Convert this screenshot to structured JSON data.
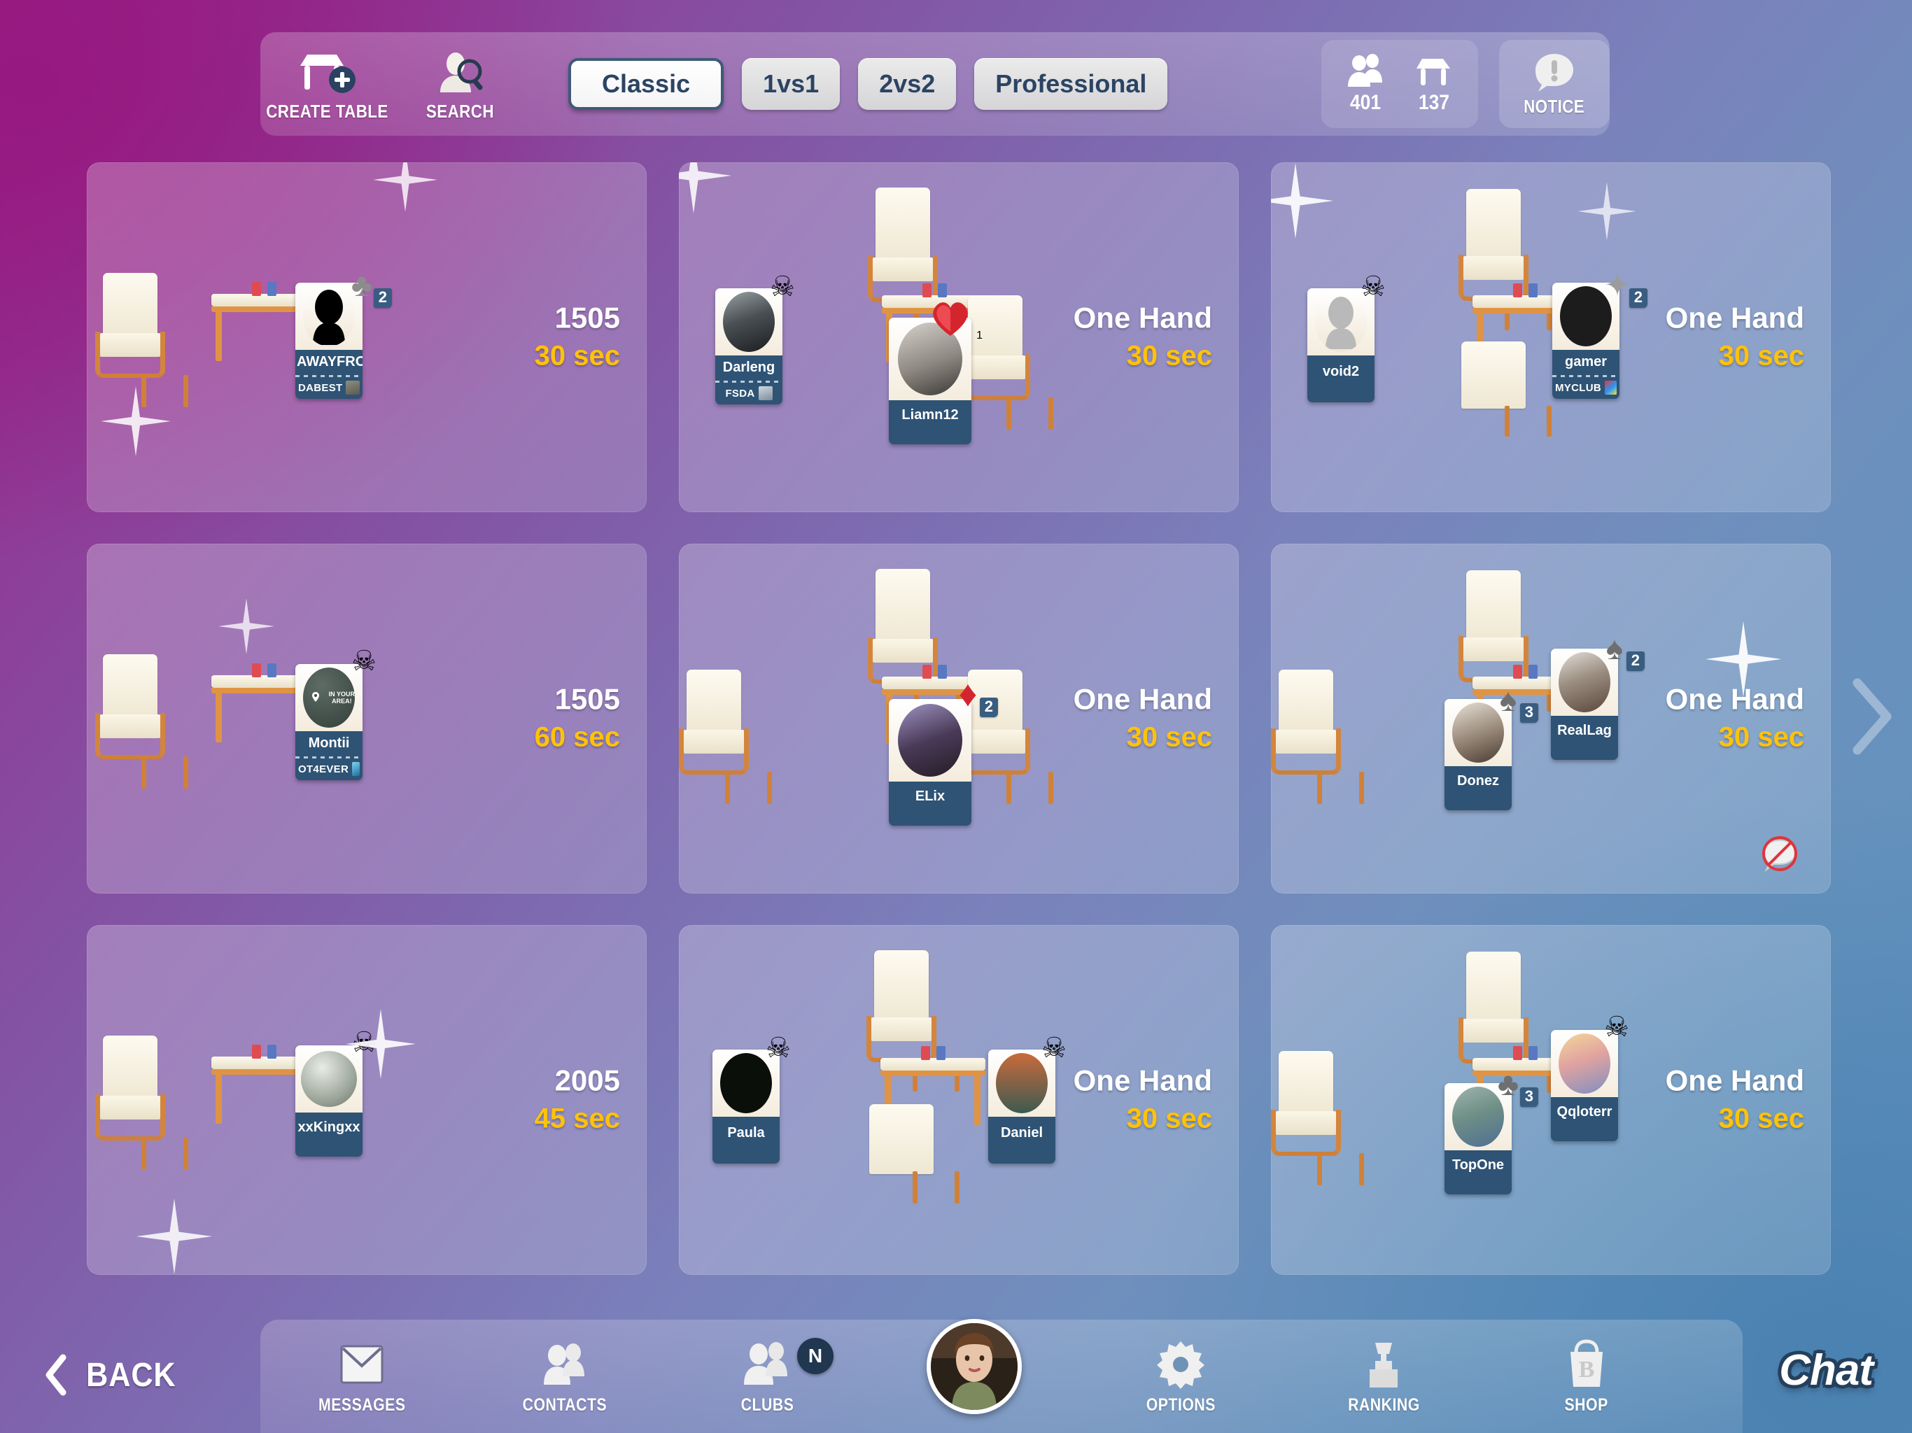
{
  "toolbar": {
    "create_table_label": "CREATE TABLE",
    "search_label": "SEARCH",
    "modes": [
      {
        "label": "Classic",
        "active": true
      },
      {
        "label": "1vs1",
        "active": false
      },
      {
        "label": "2vs2",
        "active": false
      },
      {
        "label": "Professional",
        "active": false
      }
    ],
    "players_online": "401",
    "tables_open": "137",
    "notice_label": "NOTICE"
  },
  "tables": [
    {
      "layout": "single-left",
      "meta_mode": "1505",
      "meta_time": "30 sec",
      "no_chat": false,
      "players": [
        {
          "name": "AWAYFRO",
          "club": "DABEST",
          "avatar_kind": "silhouette-dark",
          "suit": "club",
          "level": "2",
          "skull": false,
          "pos": "right"
        }
      ]
    },
    {
      "layout": "two-seat",
      "meta_mode": "One Hand",
      "meta_time": "30 sec",
      "no_chat": false,
      "players": [
        {
          "name": "Darleng",
          "club": "FSDA",
          "avatar_kind": "photo-goth",
          "suit": "",
          "level": "",
          "skull": true,
          "pos": "left"
        },
        {
          "name": "Liamn12",
          "club": "",
          "avatar_kind": "photo-man-glasses",
          "suit": "heart",
          "level": "1",
          "skull": false,
          "pos": "center"
        }
      ]
    },
    {
      "layout": "two-seat",
      "meta_mode": "One Hand",
      "meta_time": "30 sec",
      "no_chat": false,
      "players": [
        {
          "name": "void2",
          "club": "",
          "avatar_kind": "silhouette-grey",
          "suit": "",
          "level": "",
          "skull": true,
          "pos": "left"
        },
        {
          "name": "gamer",
          "club": "MYCLUB",
          "avatar_kind": "black-circle",
          "suit": "star",
          "level": "2",
          "skull": false,
          "pos": "right"
        }
      ]
    },
    {
      "layout": "single-left",
      "meta_mode": "1505",
      "meta_time": "60 sec",
      "no_chat": false,
      "players": [
        {
          "name": "Montii",
          "club": "OT4EVER",
          "avatar_kind": "in-your-area",
          "suit": "",
          "level": "",
          "skull": true,
          "pos": "right"
        }
      ]
    },
    {
      "layout": "two-seat",
      "meta_mode": "One Hand",
      "meta_time": "30 sec",
      "no_chat": false,
      "players": [
        {
          "name": "ELix",
          "club": "",
          "avatar_kind": "photo-cap-girl",
          "suit": "diamond",
          "level": "2",
          "skull": false,
          "pos": "center"
        }
      ]
    },
    {
      "layout": "two-seat",
      "meta_mode": "One Hand",
      "meta_time": "30 sec",
      "no_chat": true,
      "players": [
        {
          "name": "Donez",
          "club": "",
          "avatar_kind": "photo-girl-glasses",
          "suit": "spade",
          "level": "3",
          "skull": false,
          "pos": "centerleft"
        },
        {
          "name": "RealLag",
          "club": "",
          "avatar_kind": "photo-curly-man",
          "suit": "spade",
          "level": "2",
          "skull": false,
          "pos": "right"
        }
      ]
    },
    {
      "layout": "single-left",
      "meta_mode": "2005",
      "meta_time": "45 sec",
      "no_chat": false,
      "players": [
        {
          "name": "xxKingxx",
          "club": "",
          "avatar_kind": "grey-sphere",
          "suit": "",
          "level": "",
          "skull": true,
          "pos": "right"
        }
      ]
    },
    {
      "layout": "two-seat",
      "meta_mode": "One Hand",
      "meta_time": "30 sec",
      "no_chat": false,
      "players": [
        {
          "name": "Paula",
          "club": "",
          "avatar_kind": "black-oval",
          "suit": "",
          "level": "",
          "skull": true,
          "pos": "left"
        },
        {
          "name": "Daniel",
          "club": "",
          "avatar_kind": "photo-meme",
          "suit": "",
          "level": "",
          "skull": true,
          "pos": "right"
        }
      ]
    },
    {
      "layout": "two-seat",
      "meta_mode": "One Hand",
      "meta_time": "30 sec",
      "no_chat": false,
      "players": [
        {
          "name": "TopOne",
          "club": "",
          "avatar_kind": "photo-shoes",
          "suit": "club",
          "level": "3",
          "skull": false,
          "pos": "centerleft"
        },
        {
          "name": "Qqloterr",
          "club": "",
          "avatar_kind": "photo-blonde",
          "suit": "",
          "level": "",
          "skull": true,
          "pos": "right"
        }
      ]
    }
  ],
  "bottom_nav": {
    "back_label": "BACK",
    "items": [
      {
        "label": "MESSAGES",
        "icon": "envelope-icon",
        "badge": ""
      },
      {
        "label": "CONTACTS",
        "icon": "contacts-icon",
        "badge": ""
      },
      {
        "label": "CLUBS",
        "icon": "clubs-icon",
        "badge": "N"
      }
    ],
    "items_right": [
      {
        "label": "OPTIONS",
        "icon": "gear-icon",
        "badge": ""
      },
      {
        "label": "RANKING",
        "icon": "trophy-icon",
        "badge": ""
      },
      {
        "label": "SHOP",
        "icon": "shopping-bag-icon",
        "badge": ""
      }
    ],
    "chat_label": "Chat"
  },
  "colors": {
    "accent_timer": "#ffc20a",
    "plaque_blue": "#2e5375",
    "mode_text": "#2c4463",
    "bg_magenta": "#9b1f84",
    "bg_blue": "#5f8fbd"
  }
}
